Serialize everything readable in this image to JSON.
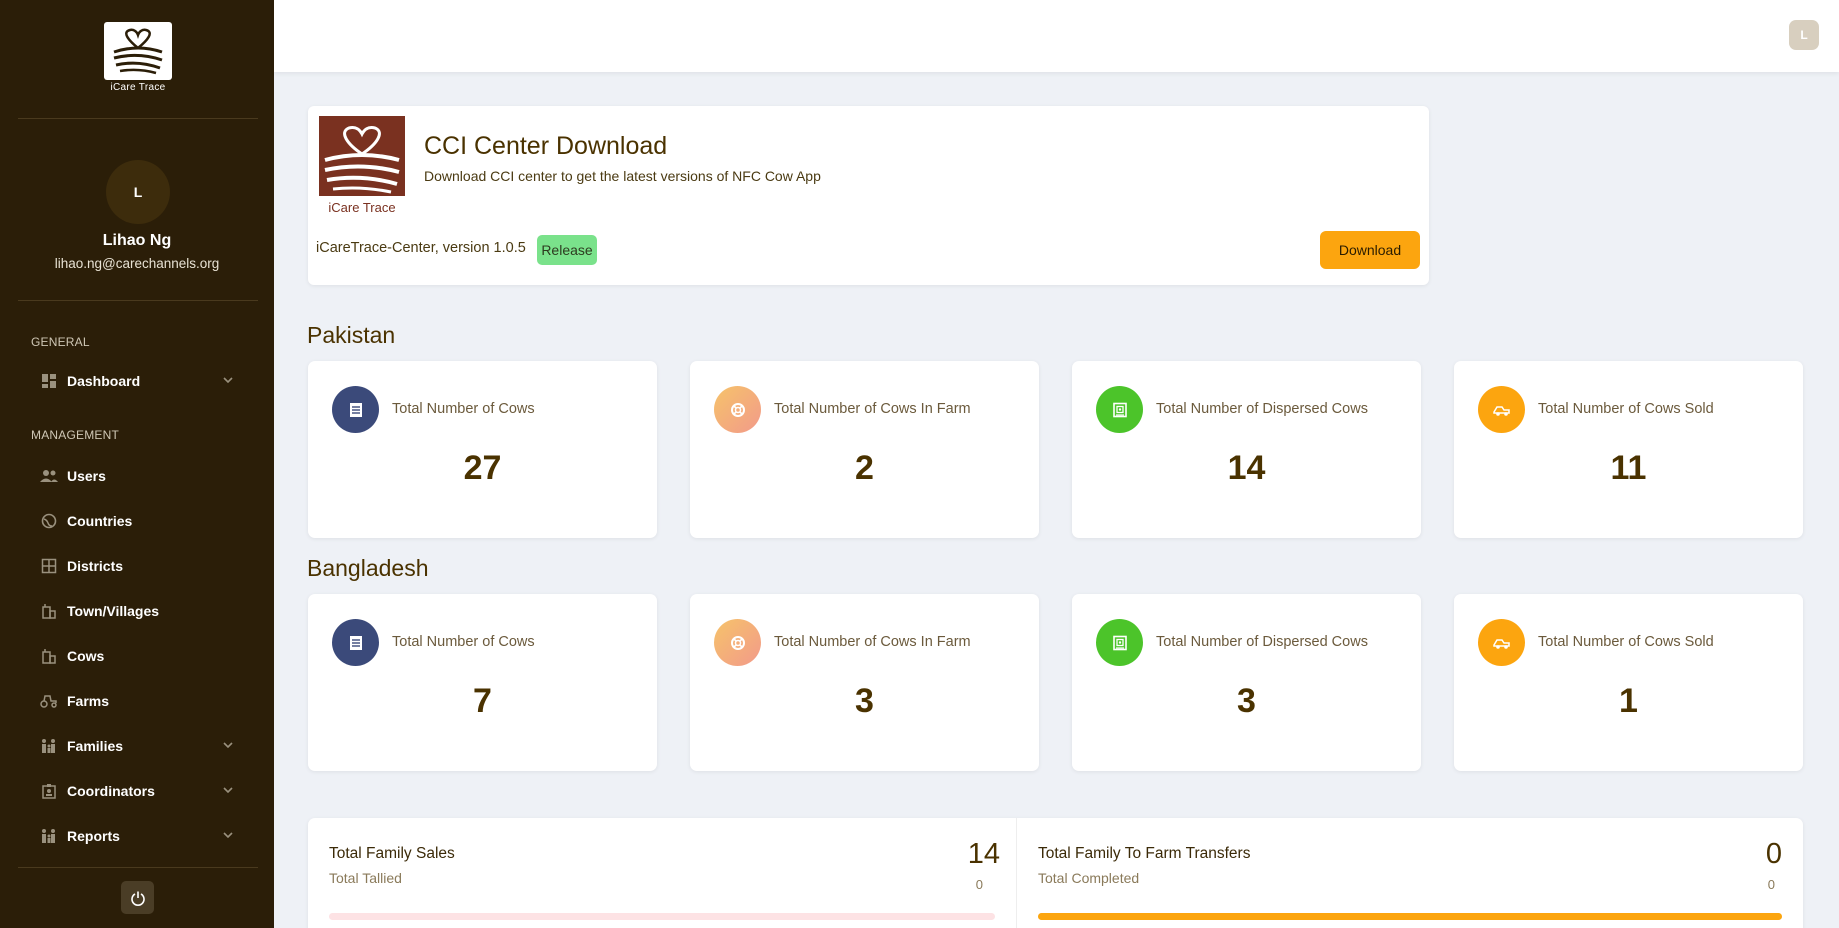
{
  "sidebar": {
    "logo_text": "iCare Trace",
    "avatar_initial": "L",
    "user_name": "Lihao Ng",
    "user_email": "lihao.ng@carechannels.org",
    "general_label": "GENERAL",
    "management_label": "MANAGEMENT",
    "items": [
      {
        "label": "Dashboard",
        "icon": "dashboard-icon",
        "expandable": true
      },
      {
        "label": "Users",
        "icon": "users-icon",
        "expandable": false
      },
      {
        "label": "Countries",
        "icon": "globe-icon",
        "expandable": false
      },
      {
        "label": "Districts",
        "icon": "grid-icon",
        "expandable": false
      },
      {
        "label": "Town/Villages",
        "icon": "building-icon",
        "expandable": false
      },
      {
        "label": "Cows",
        "icon": "building-icon",
        "expandable": false
      },
      {
        "label": "Farms",
        "icon": "tractor-icon",
        "expandable": false
      },
      {
        "label": "Families",
        "icon": "family-icon",
        "expandable": true
      },
      {
        "label": "Coordinators",
        "icon": "badge-icon",
        "expandable": true
      },
      {
        "label": "Reports",
        "icon": "family-icon",
        "expandable": true
      }
    ]
  },
  "topbar": {
    "avatar_initial": "L"
  },
  "download_card": {
    "logo_text": "iCare Trace",
    "title": "CCI Center Download",
    "subtitle": "Download CCI center to get the latest versions of NFC Cow App",
    "version": "iCareTrace-Center, version 1.0.5",
    "badge": "Release",
    "button": "Download"
  },
  "countries": [
    {
      "name": "Pakistan",
      "stats": [
        {
          "label": "Total Number of Cows",
          "value": "27",
          "icon": "list-icon",
          "color": "#3b4a7a"
        },
        {
          "label": "Total Number of Cows In Farm",
          "value": "2",
          "icon": "life-ring-icon",
          "color": "#f6ad6a"
        },
        {
          "label": "Total Number of Dispersed Cows",
          "value": "14",
          "icon": "safe-icon",
          "color": "#4cc42a"
        },
        {
          "label": "Total Number of Cows Sold",
          "value": "11",
          "icon": "truck-icon",
          "color": "#fca50f"
        }
      ]
    },
    {
      "name": "Bangladesh",
      "stats": [
        {
          "label": "Total Number of Cows",
          "value": "7",
          "icon": "list-icon",
          "color": "#3b4a7a"
        },
        {
          "label": "Total Number of Cows In Farm",
          "value": "3",
          "icon": "life-ring-icon",
          "color": "#f6ad6a"
        },
        {
          "label": "Total Number of Dispersed Cows",
          "value": "3",
          "icon": "safe-icon",
          "color": "#4cc42a"
        },
        {
          "label": "Total Number of Cows Sold",
          "value": "1",
          "icon": "truck-icon",
          "color": "#fca50f"
        }
      ]
    }
  ],
  "summary": {
    "left": {
      "title": "Total Family Sales",
      "sub": "Total Tallied",
      "big": "14",
      "small": "0",
      "progress": 0,
      "bar_color": "#fde2e4"
    },
    "right": {
      "title": "Total Family To Farm Transfers",
      "sub": "Total Completed",
      "big": "0",
      "small": "0",
      "progress": 1,
      "bar_color": "#fca50f"
    }
  }
}
